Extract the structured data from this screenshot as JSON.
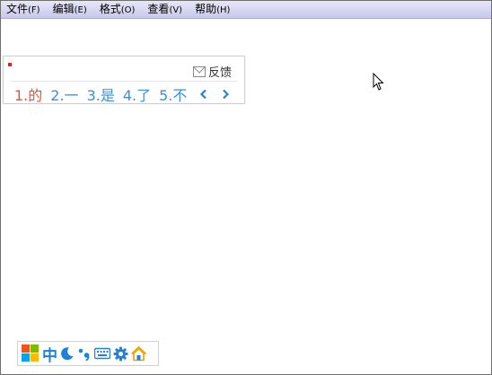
{
  "menu": [
    {
      "label": "文件",
      "hotkey": "(F)"
    },
    {
      "label": "编辑",
      "hotkey": "(E)"
    },
    {
      "label": "格式",
      "hotkey": "(O)"
    },
    {
      "label": "查看",
      "hotkey": "(V)"
    },
    {
      "label": "帮助",
      "hotkey": "(H)"
    }
  ],
  "ime": {
    "feedback_label": "反馈",
    "candidates": [
      "1.的",
      "2.一",
      "3.是",
      "4.了",
      "5.不"
    ],
    "colors": {
      "selected": "#e8512c",
      "candidate": "#3a8fd8"
    }
  },
  "toolbar": {
    "mode_label": "中",
    "icons": [
      "sogou-logo-icon",
      "moon-icon",
      "punctuation-icon",
      "keyboard-icon",
      "gear-icon",
      "home-icon"
    ]
  }
}
